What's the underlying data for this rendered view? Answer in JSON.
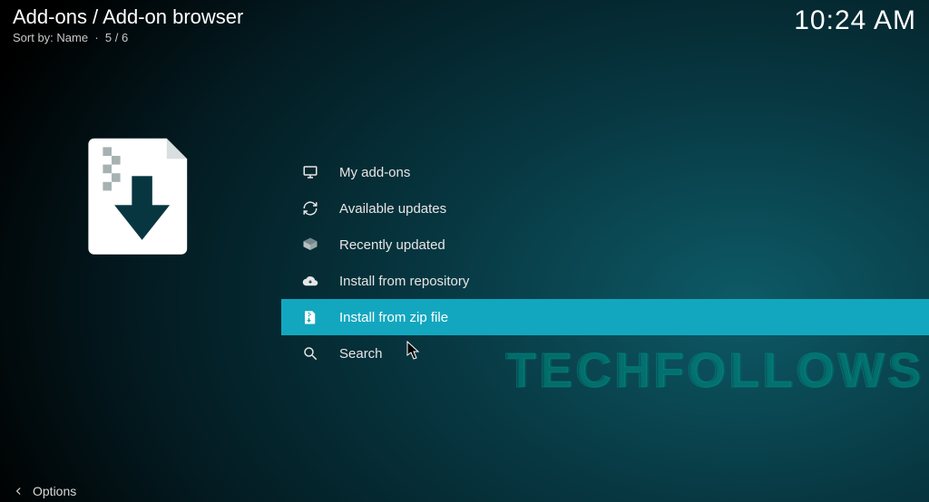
{
  "header": {
    "title": "Add-ons / Add-on browser",
    "sort_label": "Sort by: Name",
    "position": "5 / 6",
    "clock": "10:24 AM"
  },
  "menu": {
    "items": [
      {
        "label": "My add-ons",
        "icon": "monitor-icon",
        "selected": false
      },
      {
        "label": "Available updates",
        "icon": "refresh-icon",
        "selected": false
      },
      {
        "label": "Recently updated",
        "icon": "box-open-icon",
        "selected": false
      },
      {
        "label": "Install from repository",
        "icon": "cloud-download-icon",
        "selected": false
      },
      {
        "label": "Install from zip file",
        "icon": "zip-file-icon",
        "selected": true
      },
      {
        "label": "Search",
        "icon": "search-icon",
        "selected": false
      }
    ]
  },
  "footer": {
    "options": "Options"
  },
  "watermark": "TECHFOLLOWS"
}
